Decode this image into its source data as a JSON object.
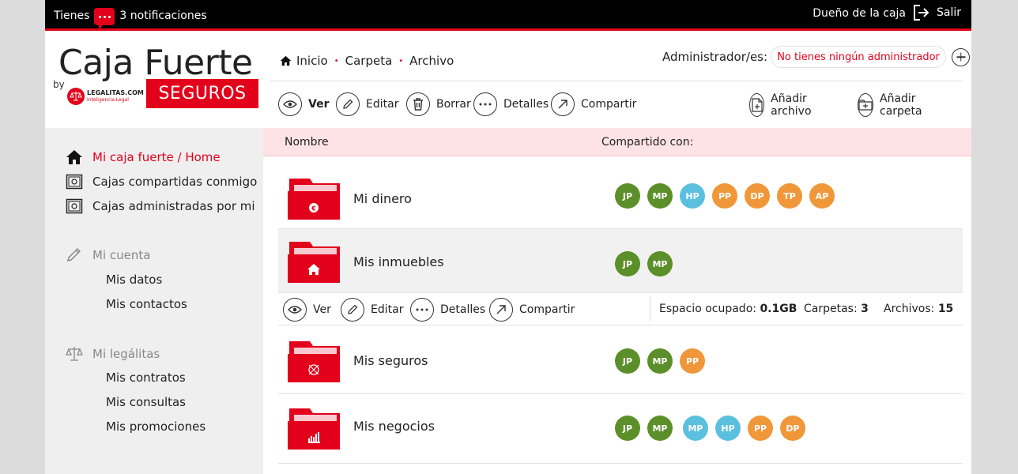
{
  "topbar": {
    "notif_prefix": "Tienes",
    "notif_count_text": "3 notificaciones",
    "owner": "Dueño de la caja",
    "logout": "Salir"
  },
  "logo": {
    "title": "Caja Fuerte",
    "by": "by",
    "legal_name": "LEGALITAS.COM",
    "legal_tagline": "Inteligencia Legal",
    "seguros": "SEGUROS"
  },
  "breadcrumb": [
    "Inicio",
    "Carpeta",
    "Archivo"
  ],
  "admin": {
    "label": "Administrador/es:",
    "value": "No tienes ningún administrador"
  },
  "toolbar": {
    "ver": "Ver",
    "editar": "Editar",
    "borrar": "Borrar",
    "detalles": "Detalles",
    "compartir": "Compartir",
    "add_file": "Añadir archivo",
    "add_folder": "Añadir carpeta"
  },
  "sidebar": {
    "home": "Mi caja fuerte / Home",
    "shared": "Cajas compartidas conmigo",
    "managed": "Cajas administradas por mi",
    "account_section": "Mi cuenta",
    "account_items": [
      "Mis datos",
      "Mis contactos"
    ],
    "legal_section": "Mi legálitas",
    "legal_items": [
      "Mis contratos",
      "Mis consultas",
      "Mis promociones"
    ]
  },
  "table": {
    "col_name": "Nombre",
    "col_shared": "Compartido con:",
    "rows": [
      {
        "name": "Mi dinero",
        "avatars": [
          [
            "JP",
            "g"
          ],
          [
            "MP",
            "g"
          ],
          [
            "HP",
            "b"
          ],
          [
            "PP",
            "o"
          ],
          [
            "DP",
            "o"
          ],
          [
            "TP",
            "o"
          ],
          [
            "AP",
            "o"
          ]
        ]
      },
      {
        "name": "Mis inmuebles",
        "avatars": [
          [
            "JP",
            "g"
          ],
          [
            "MP",
            "g"
          ]
        ]
      },
      {
        "name": "Mis seguros",
        "avatars": [
          [
            "JP",
            "g"
          ],
          [
            "MP",
            "g"
          ],
          [
            "PP",
            "o"
          ]
        ]
      },
      {
        "name": "Mis negocios",
        "avatars": [
          [
            "JP",
            "g"
          ],
          [
            "MP",
            "g"
          ],
          [
            "MP",
            "b"
          ],
          [
            "HP",
            "b"
          ],
          [
            "PP",
            "o"
          ],
          [
            "DP",
            "o"
          ]
        ]
      }
    ]
  },
  "row_actions": {
    "ver": "Ver",
    "editar": "Editar",
    "detalles": "Detalles",
    "compartir": "Compartir",
    "space_label": "Espacio ocupado:",
    "space_value": "0.1GB",
    "folders_label": "Carpetas:",
    "folders_value": "3",
    "files_label": "Archivos:",
    "files_value": "15"
  },
  "colors": {
    "accent": "#e3001b",
    "green": "#5a8f29",
    "blue": "#5bc0de",
    "orange": "#f0973a"
  }
}
